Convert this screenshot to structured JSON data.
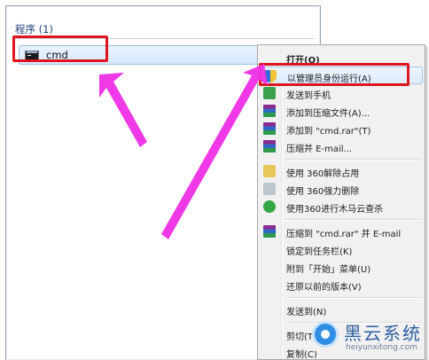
{
  "start_menu": {
    "group_header": "程序 (1)",
    "result": {
      "label": "cmd",
      "icon": "console-icon"
    }
  },
  "context_menu": {
    "items": [
      {
        "label": "打开(O)",
        "bold": true,
        "icon": ""
      },
      {
        "label": "以管理员身份运行(A)",
        "icon": "uac-shield-icon",
        "highlighted": true
      },
      {
        "label": "发送到手机",
        "icon": "send-to-phone-icon"
      },
      {
        "label": "添加到压缩文件(A)...",
        "icon": "winrar-icon"
      },
      {
        "label": "添加到 \"cmd.rar\"(T)",
        "icon": "winrar-icon"
      },
      {
        "label": "压缩并 E-mail...",
        "icon": "winrar-icon"
      },
      {
        "label": "使用 360解除占用",
        "icon": "folder-360-icon"
      },
      {
        "label": "使用 360强力删除",
        "icon": "shredder-icon"
      },
      {
        "label": "使用360进行木马云查杀",
        "icon": "360-shield-icon"
      },
      {
        "label": "压缩到 \"cmd.rar\" 并 E-mail",
        "icon": "winrar-icon"
      },
      {
        "label": "锁定到任务栏(K)",
        "icon": ""
      },
      {
        "label": "附到「开始」菜单(U)",
        "icon": ""
      },
      {
        "label": "还原以前的版本(V)",
        "icon": ""
      },
      {
        "label": "发送到(N)",
        "icon": ""
      },
      {
        "label": "剪切(T)",
        "icon": ""
      },
      {
        "label": "复制(C)",
        "icon": ""
      }
    ]
  },
  "annotations": {
    "highlight_color": "#e0141e",
    "arrow_color": "#ee2ee6"
  },
  "watermark": {
    "title": "黑云系统",
    "url": "heiyunxitong.com"
  }
}
